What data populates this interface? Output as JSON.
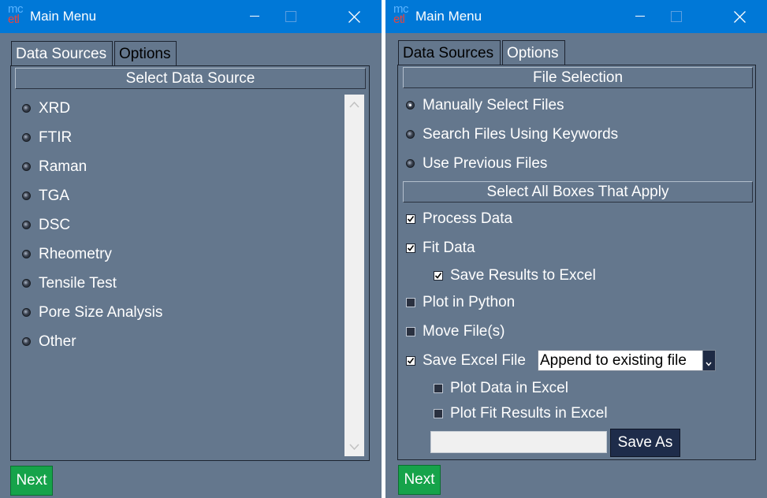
{
  "windows": [
    {
      "title": "Main Menu",
      "logo": {
        "top": "mc",
        "bottom": "etl"
      },
      "tabs": [
        {
          "label": "Data Sources",
          "active": true
        },
        {
          "label": "Options",
          "active": false
        }
      ],
      "header": "Select Data Source",
      "radio_options": [
        "XRD",
        "FTIR",
        "Raman",
        "TGA",
        "DSC",
        "Rheometry",
        "Tensile Test",
        "Pore Size Analysis",
        "Other"
      ],
      "next_label": "Next"
    },
    {
      "title": "Main Menu",
      "logo": {
        "top": "mc",
        "bottom": "etl"
      },
      "tabs": [
        {
          "label": "Data Sources",
          "active": false
        },
        {
          "label": "Options",
          "active": true
        }
      ],
      "file_selection": {
        "header": "File Selection",
        "options": [
          {
            "label": "Manually Select Files",
            "selected": true
          },
          {
            "label": "Search Files Using Keywords",
            "selected": false
          },
          {
            "label": "Use Previous Files",
            "selected": false
          }
        ]
      },
      "boxes": {
        "header": "Select All Boxes That Apply",
        "process_data": {
          "label": "Process Data",
          "checked": true
        },
        "fit_data": {
          "label": "Fit Data",
          "checked": true
        },
        "save_results_excel": {
          "label": "Save Results to Excel",
          "checked": true
        },
        "plot_python": {
          "label": "Plot in Python",
          "checked": false
        },
        "move_files": {
          "label": "Move File(s)",
          "checked": false
        },
        "save_excel": {
          "label": "Save Excel File",
          "checked": true
        },
        "plot_data_excel": {
          "label": "Plot Data in Excel",
          "checked": false
        },
        "plot_fit_excel": {
          "label": "Plot Fit Results in Excel",
          "checked": false
        }
      },
      "excel_mode": {
        "selected": "Append to existing file"
      },
      "filename": {
        "value": "",
        "placeholder": ""
      },
      "save_as_label": "Save As",
      "next_label": "Next"
    }
  ],
  "colors": {
    "titlebar": "#0078d7",
    "window_bg": "#64778d",
    "next_button": "#16a34a",
    "save_as_button": "#1e2c4a"
  }
}
